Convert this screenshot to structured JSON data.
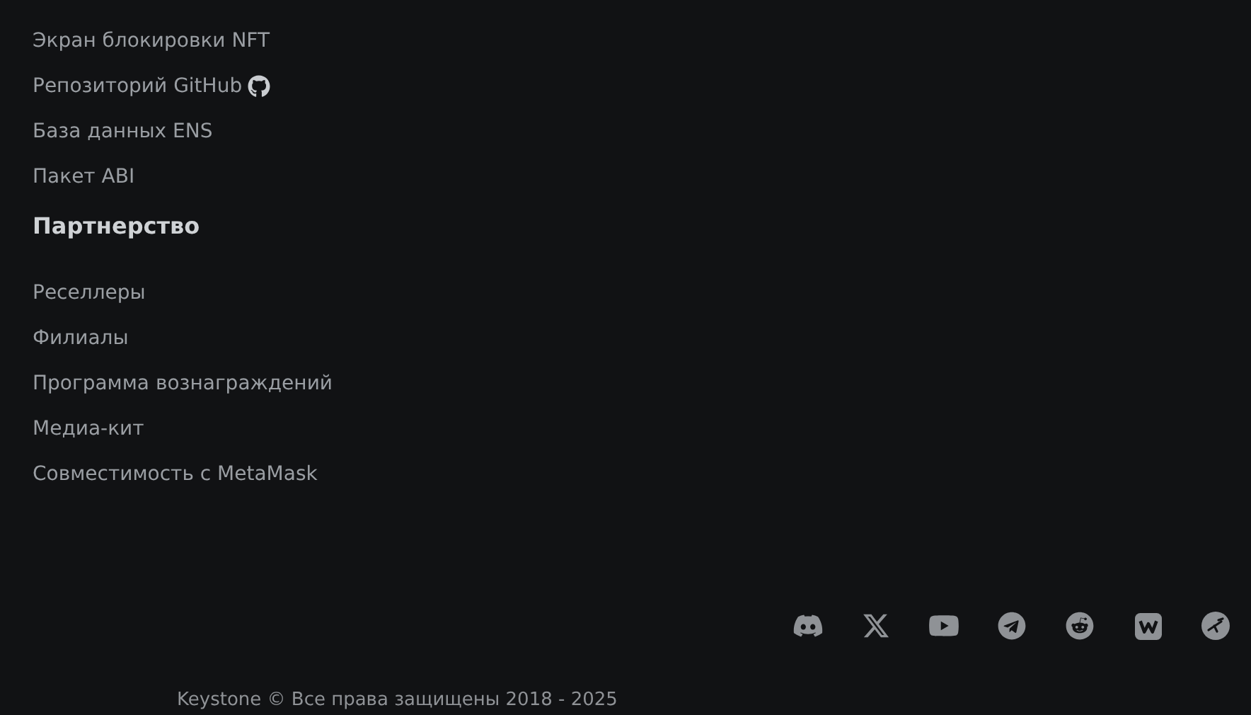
{
  "links_top": [
    {
      "label": "Экран блокировки NFT",
      "kind": "text"
    },
    {
      "label": "Репозиторий GitHub",
      "kind": "github"
    },
    {
      "label": "База данных ENS",
      "kind": "text"
    },
    {
      "label": "Пакет ABI",
      "kind": "text"
    }
  ],
  "partnership": {
    "heading": "Партнерство",
    "links": [
      {
        "label": "Реселлеры"
      },
      {
        "label": "Филиалы"
      },
      {
        "label": "Программа вознаграждений"
      },
      {
        "label": "Медиа-кит"
      },
      {
        "label": "Совместимость с MetaMask"
      }
    ]
  },
  "social": [
    {
      "kind": "discord"
    },
    {
      "kind": "x"
    },
    {
      "kind": "youtube"
    },
    {
      "kind": "telegram"
    },
    {
      "kind": "reddit"
    },
    {
      "kind": "w"
    },
    {
      "kind": "bird"
    }
  ],
  "copyright": "Keystone © Все права защищены 2018 - 2025"
}
